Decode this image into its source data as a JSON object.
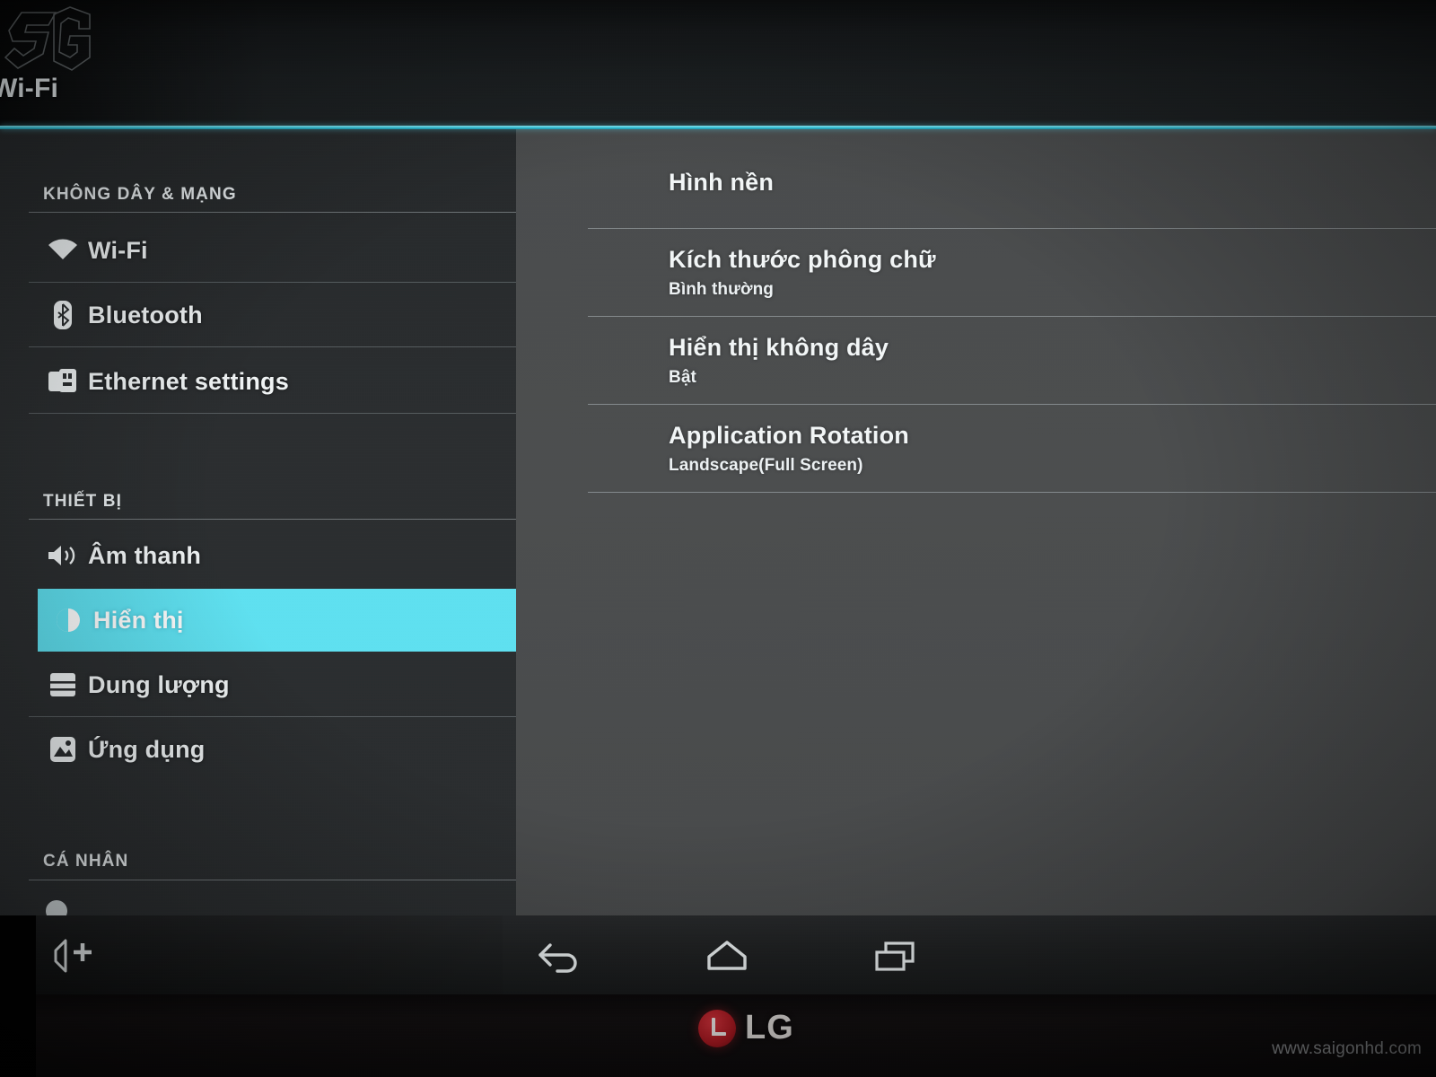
{
  "watermarks": {
    "logo_mark": "SG",
    "site": "www.saigonhd.com"
  },
  "topbar": {
    "breadcrumb": "Wi-Fi"
  },
  "colors": {
    "accent_cyan": "#5fe2f2",
    "rule_cyan": "#3fd2e8",
    "sidebar_bg": "#2a2d2f",
    "content_bg": "#4a4c4d",
    "navbar_bg": "#202223",
    "lg_red": "#a8171f"
  },
  "sidebar": {
    "sections": [
      {
        "header": "KHÔNG DÂY & MẠNG",
        "items": [
          {
            "label": "Wi-Fi",
            "icon": "wifi-icon",
            "selected": false
          },
          {
            "label": "Bluetooth",
            "icon": "bluetooth-icon",
            "selected": false
          },
          {
            "label": "Ethernet settings",
            "icon": "ethernet-icon",
            "selected": false
          }
        ]
      },
      {
        "header": "THIẾT BỊ",
        "items": [
          {
            "label": "Âm thanh",
            "icon": "speaker-icon",
            "selected": false
          },
          {
            "label": "Hiển thị",
            "icon": "brightness-icon",
            "selected": true
          },
          {
            "label": "Dung lượng",
            "icon": "storage-icon",
            "selected": false
          },
          {
            "label": "Ứng dụng",
            "icon": "apps-icon",
            "selected": false
          }
        ]
      },
      {
        "header": "CÁ NHÂN",
        "items": []
      }
    ]
  },
  "content": {
    "rows": [
      {
        "title": "Hình nền",
        "subtitle": ""
      },
      {
        "title": "Kích thước phông chữ",
        "subtitle": "Bình thường"
      },
      {
        "title": "Hiển thị không dây",
        "subtitle": "Bật"
      },
      {
        "title": "Application Rotation",
        "subtitle": "Landscape(Full Screen)"
      }
    ]
  },
  "navbar": {
    "buttons": [
      {
        "name": "volume-up-icon",
        "label": "Volume up"
      },
      {
        "name": "back-icon",
        "label": "Back"
      },
      {
        "name": "home-icon",
        "label": "Home"
      },
      {
        "name": "recents-icon",
        "label": "Recent apps"
      }
    ]
  },
  "device": {
    "brand": "LG"
  }
}
